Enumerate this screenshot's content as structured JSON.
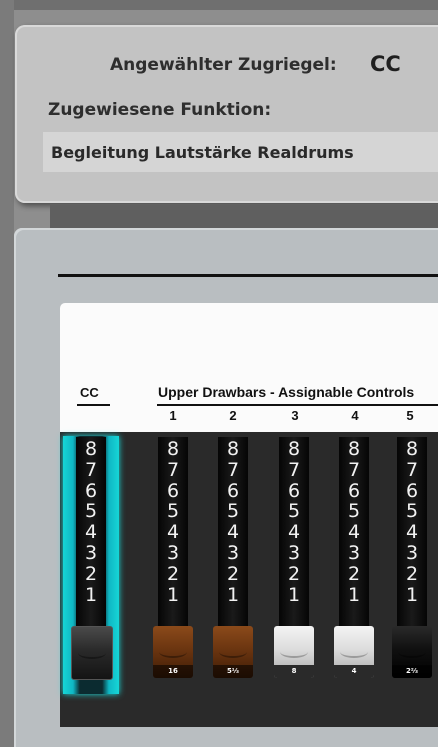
{
  "info_panel": {
    "selected_label": "Angewählter Zugriegel:",
    "selected_value": "CC",
    "assigned_label": "Zugewiesene Funktion:",
    "assigned_value": "Begleitung Lautstärke Realdrums"
  },
  "drawbar_section": {
    "cc_heading": "CC",
    "upper_heading": "Upper Drawbars - Assignable Controls",
    "scale_numbers": [
      "8",
      "7",
      "6",
      "5",
      "4",
      "3",
      "2",
      "1"
    ],
    "columns": [
      {
        "number": "",
        "knob_color": "black",
        "footage": "",
        "selected": true
      },
      {
        "number": "1",
        "knob_color": "brown",
        "footage": "16"
      },
      {
        "number": "2",
        "knob_color": "brown",
        "footage": "5⅓"
      },
      {
        "number": "3",
        "knob_color": "white",
        "footage": "8"
      },
      {
        "number": "4",
        "knob_color": "white",
        "footage": "4"
      },
      {
        "number": "5",
        "knob_color": "black",
        "footage": "2⅔"
      }
    ]
  },
  "colors": {
    "selected_glow": "#16d6d6",
    "panel_bg": "#c3c3c3",
    "main_bg": "#b9bec1"
  }
}
